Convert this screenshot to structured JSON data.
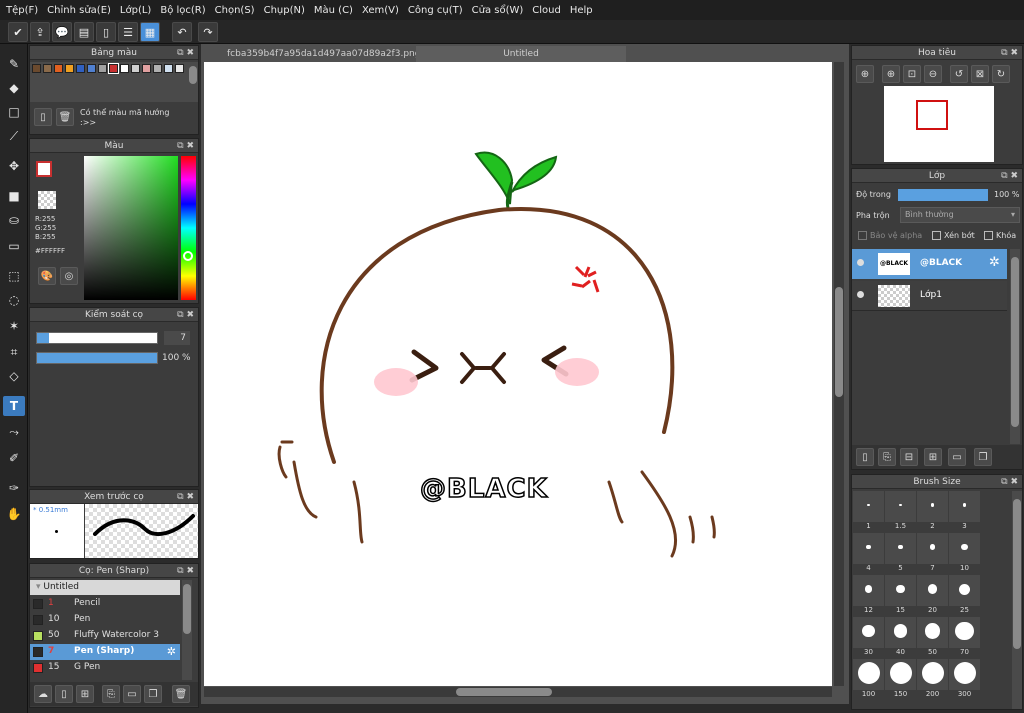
{
  "menu": [
    "Tệp(F)",
    "Chỉnh sửa(E)",
    "Lớp(L)",
    "Bộ lọc(R)",
    "Chọn(S)",
    "Chụp(N)",
    "Màu (C)",
    "Xem(V)",
    "Công cụ(T)",
    "Cửa sổ(W)",
    "Cloud",
    "Help"
  ],
  "palette_panel": {
    "title": "Bảng màu",
    "colors": [
      "#6b4a2e",
      "#8a6a4a",
      "#e06020",
      "#f0a020",
      "#3060c0",
      "#5080d0",
      "#a0a0a0",
      "#c83030",
      "#ffffff",
      "#d0d0d0",
      "#e0a0a0",
      "#b0b0b0",
      "#d0e0f0",
      "#e8e8e8"
    ],
    "note": "Có thể màu mã hướng :>>"
  },
  "color_panel": {
    "title": "Màu",
    "r": "R:255",
    "g": "G:255",
    "b": "B:255",
    "hex": "#FFFFFF"
  },
  "brush_control": {
    "title": "Kiểm soát cọ",
    "size": "7",
    "opacity": "100 %",
    "size_fraction": 0.1,
    "opacity_fraction": 1.0
  },
  "brush_preview": {
    "title": "Xem trước cọ",
    "size_label": "* 0.51mm"
  },
  "brush_list": {
    "title": "Cọ: Pen (Sharp)",
    "group": "Untitled",
    "items": [
      {
        "size": "1",
        "name": "Pencil",
        "color": "#2a2a2a"
      },
      {
        "size": "10",
        "name": "Pen",
        "color": "#2a2a2a"
      },
      {
        "size": "50",
        "name": "Fluffy Watercolor 3",
        "color": "#b8e060"
      },
      {
        "size": "7",
        "name": "Pen (Sharp)",
        "color": "#2a2a2a"
      },
      {
        "size": "15",
        "name": "G Pen",
        "color": "#e03030"
      }
    ]
  },
  "tabs": [
    "fcba359b4f7a95da1d497aa07d89a2f3.png",
    "Untitled"
  ],
  "canvas": {
    "watermark_text": "@BLACK"
  },
  "navigator": {
    "title": "Hoa tiêu"
  },
  "layers": {
    "title": "Lớp",
    "opacity_label": "Độ trong",
    "opacity_value": "100 %",
    "opacity_fraction": 1.0,
    "blend_label": "Pha trộn",
    "blend_value": "Bình thường",
    "protect_alpha": "Bảo vệ alpha",
    "clipping": "Xén bớt",
    "lock": "Khóa",
    "items": [
      {
        "thumb": "@BLACK",
        "name": "@BLACK"
      },
      {
        "thumb": "",
        "name": "Lớp1"
      }
    ]
  },
  "brush_size": {
    "title": "Brush Size",
    "sizes": [
      "1",
      "1.5",
      "2",
      "3",
      "4",
      "5",
      "7",
      "10",
      "12",
      "15",
      "20",
      "25",
      "30",
      "40",
      "50",
      "70",
      "100",
      "150",
      "200",
      "300"
    ]
  },
  "colors": {
    "accent": "#5a9ad6",
    "primary_red": "#c83030"
  }
}
